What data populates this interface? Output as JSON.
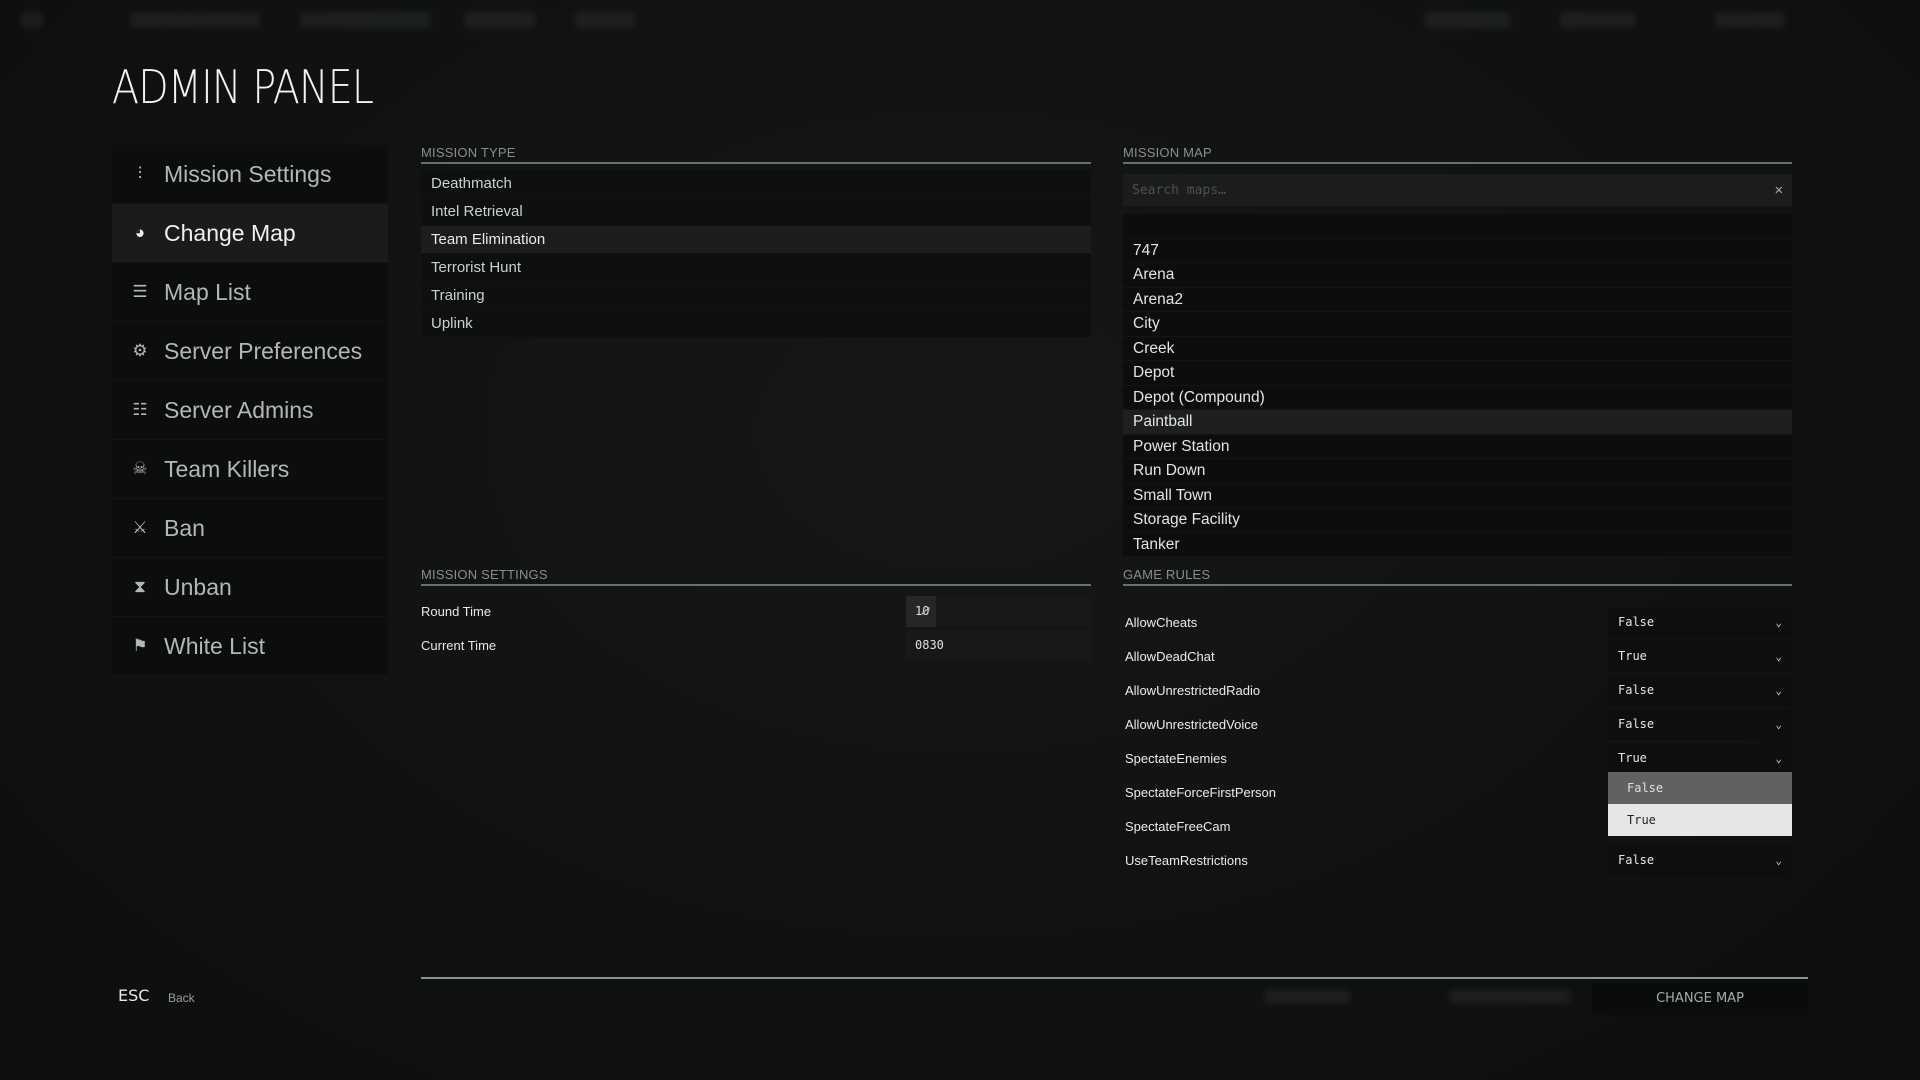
{
  "title": "ADMIN PANEL",
  "sidebar": {
    "items": [
      {
        "label": "Mission Settings",
        "icon": "sliders-icon",
        "glyph": "⫶",
        "active": false
      },
      {
        "label": "Change Map",
        "icon": "globe-icon",
        "glyph": "◕",
        "active": true
      },
      {
        "label": "Map List",
        "icon": "list-icon",
        "glyph": "☰",
        "active": false
      },
      {
        "label": "Server Preferences",
        "icon": "gear-icon",
        "glyph": "⚙",
        "active": false
      },
      {
        "label": "Server Admins",
        "icon": "admins-icon",
        "glyph": "☷",
        "active": false
      },
      {
        "label": "Team Killers",
        "icon": "team-killer-icon",
        "glyph": "☠",
        "active": false
      },
      {
        "label": "Ban",
        "icon": "ban-icon",
        "glyph": "⚔",
        "active": false
      },
      {
        "label": "Unban",
        "icon": "hourglass-icon",
        "glyph": "⧗",
        "active": false
      },
      {
        "label": "White List",
        "icon": "whitelist-icon",
        "glyph": "⚑",
        "active": false
      }
    ]
  },
  "mission_type": {
    "heading": "MISSION TYPE",
    "selected": "Team Elimination",
    "items": [
      "Deathmatch",
      "Intel Retrieval",
      "Team Elimination",
      "Terrorist Hunt",
      "Training",
      "Uplink"
    ]
  },
  "mission_map": {
    "heading": "MISSION MAP",
    "search_placeholder": "Search maps…",
    "search_value": "",
    "clear_glyph": "✕",
    "selected": "Paintball",
    "items": [
      "747",
      "Arena",
      "Arena2",
      "City",
      "Creek",
      "Depot",
      "Depot (Compound)",
      "Paintball",
      "Power Station",
      "Run Down",
      "Small Town",
      "Storage Facility",
      "Tanker"
    ]
  },
  "mission_settings": {
    "heading": "MISSION SETTINGS",
    "round_time_label": "Round Time",
    "round_time_value": "10",
    "round_time_fill_percent": 16,
    "current_time_label": "Current Time",
    "current_time_value": "0830"
  },
  "game_rules": {
    "heading": "GAME RULES",
    "rules": [
      {
        "name": "AllowCheats",
        "value": "False"
      },
      {
        "name": "AllowDeadChat",
        "value": "True"
      },
      {
        "name": "AllowUnrestrictedRadio",
        "value": "False"
      },
      {
        "name": "AllowUnrestrictedVoice",
        "value": "False"
      },
      {
        "name": "SpectateEnemies",
        "value": "True"
      },
      {
        "name": "SpectateForceFirstPerson",
        "value": ""
      },
      {
        "name": "SpectateFreeCam",
        "value": ""
      },
      {
        "name": "UseTeamRestrictions",
        "value": "False"
      }
    ],
    "open_dropdown": {
      "options": [
        {
          "label": "False",
          "bg": "#5f625e",
          "color": "#e0e0e0"
        },
        {
          "label": "True",
          "bg": "#e6e6e6",
          "color": "#222"
        }
      ]
    }
  },
  "footer": {
    "esc_key": "ESC",
    "back_label": "Back",
    "change_map_label": "CHANGE MAP"
  }
}
